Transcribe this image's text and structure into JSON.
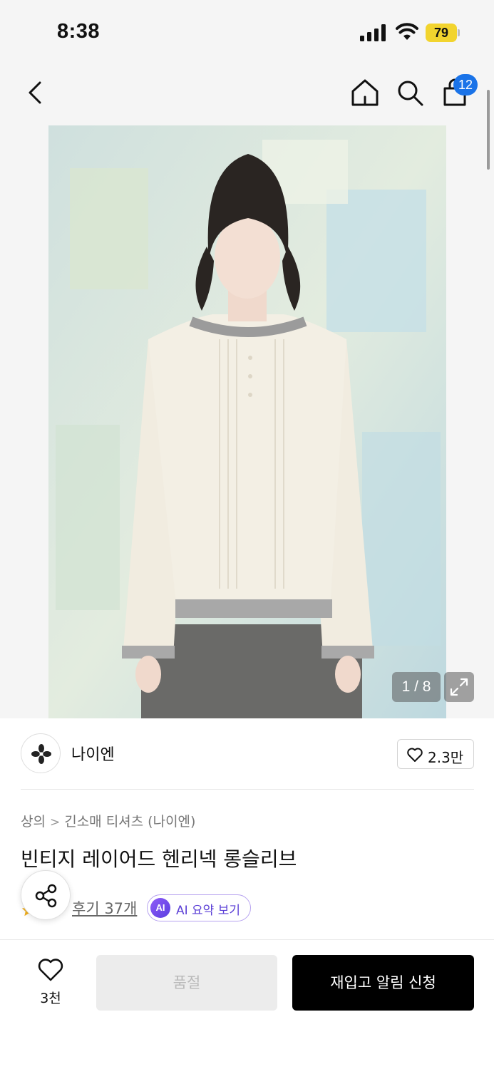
{
  "status_bar": {
    "time": "8:38",
    "battery": "79"
  },
  "nav": {
    "cart_count": "12"
  },
  "gallery": {
    "page_indicator": "1 / 8"
  },
  "brand": {
    "name": "나이엔",
    "likes": "2.3만"
  },
  "breadcrumb": [
    "상의",
    "긴소매 티셔츠 (나이엔)"
  ],
  "product": {
    "title": "빈티지 레이어드 헨리넥 롱슬리브"
  },
  "reviews": {
    "link": "후기 37개",
    "ai_summary": "AI 요약 보기",
    "ai_badge": "AI"
  },
  "bottom_bar": {
    "wish_count": "3천",
    "soldout_label": "품절",
    "restock_label": "재입고 알림 신청"
  },
  "colors": {
    "accent_badge": "#1a73e8",
    "primary_button": "#000000",
    "ai_purple": "#5b3fd6",
    "battery": "#f2d42e"
  },
  "icons": [
    "back-icon",
    "home-icon",
    "search-icon",
    "bag-icon",
    "expand-icon",
    "brand-logo-icon",
    "heart-icon",
    "star-icon",
    "share-icon"
  ]
}
